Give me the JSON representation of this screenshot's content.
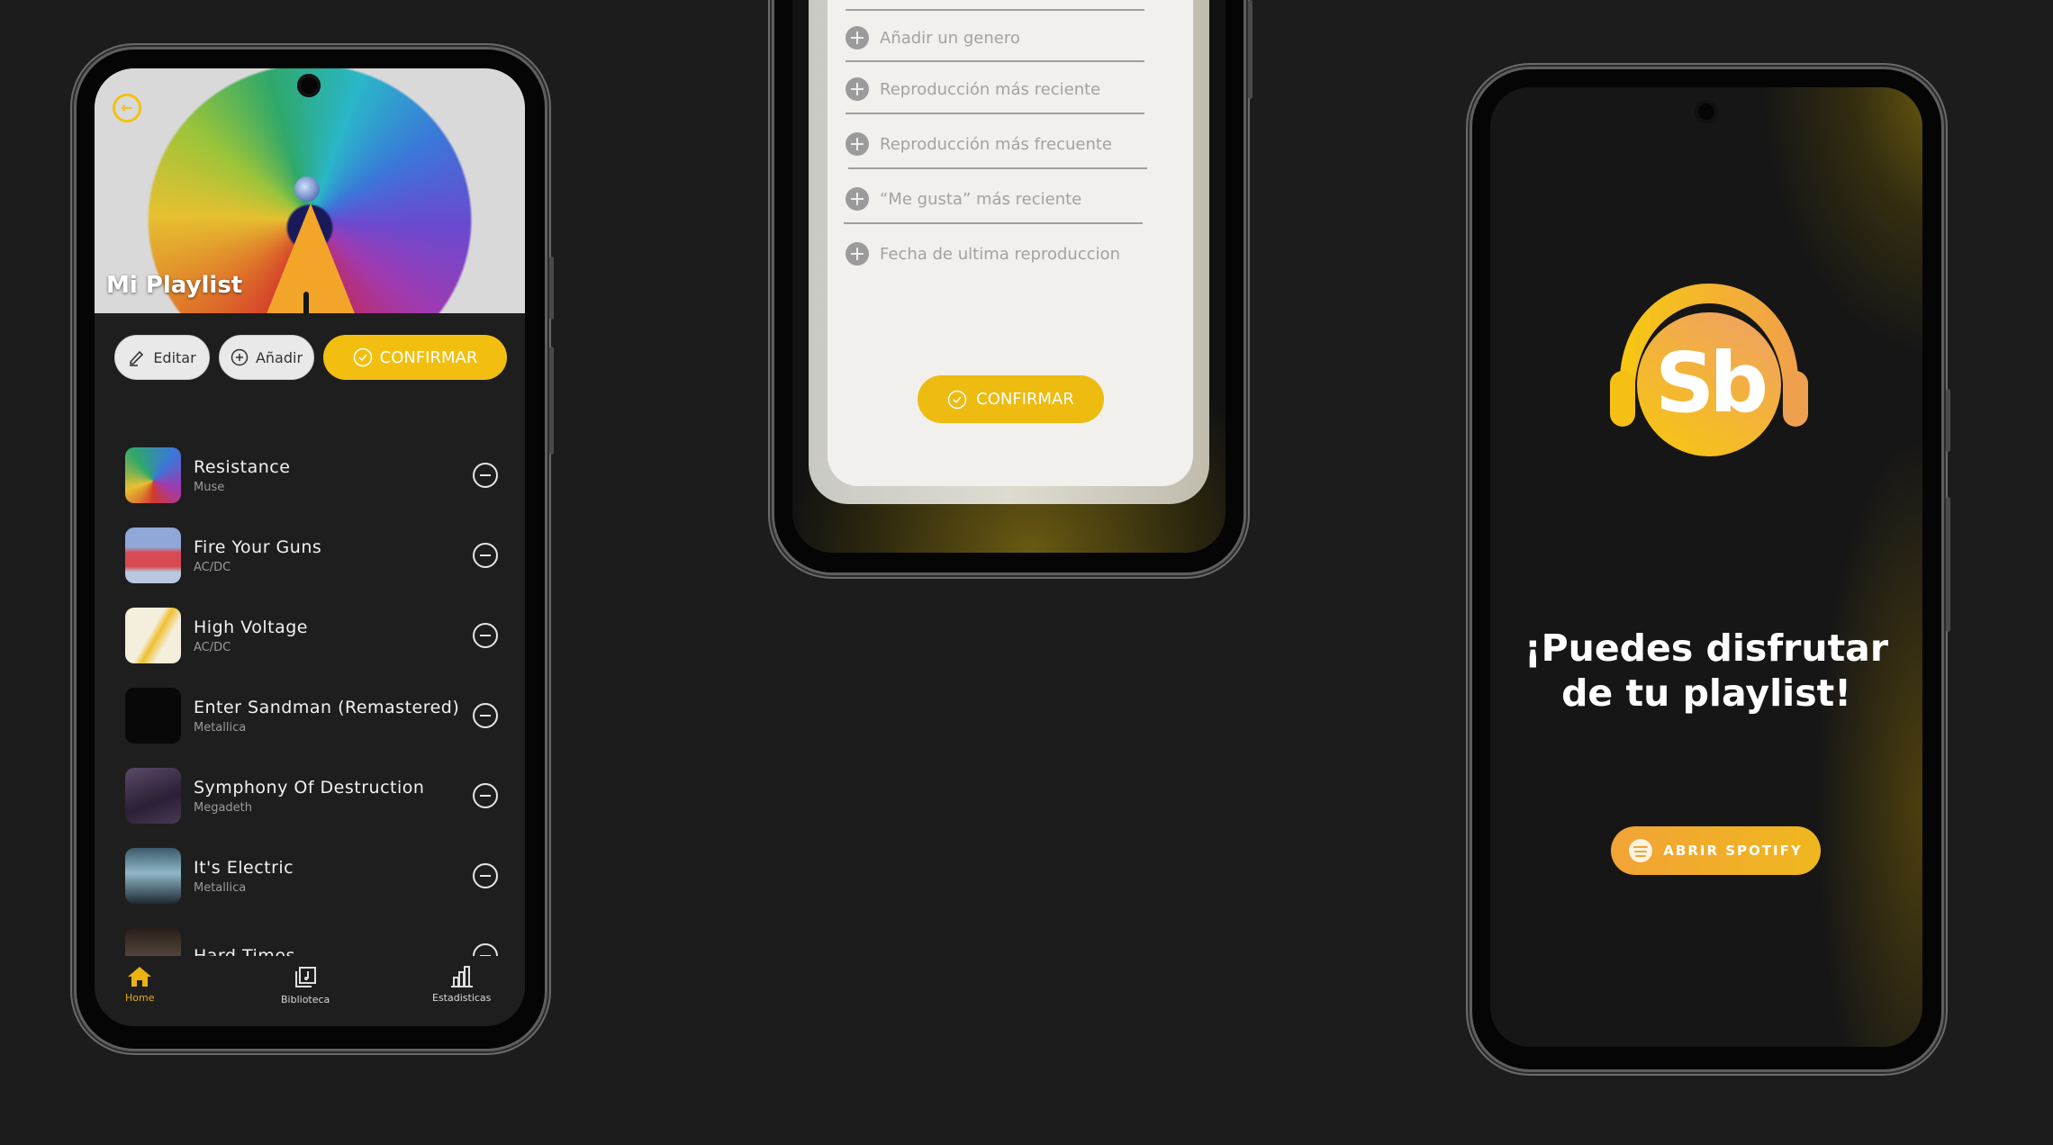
{
  "screens": {
    "playlist": {
      "title": "Mi Playlist",
      "back_icon": "arrow-left-circle-icon",
      "buttons": {
        "edit": "Editar",
        "add": "Añadir",
        "confirm": "CONFIRMAR"
      },
      "songs": [
        {
          "title": "Resistance",
          "artist": "Muse"
        },
        {
          "title": "Fire Your Guns",
          "artist": "AC/DC"
        },
        {
          "title": "High Voltage",
          "artist": "AC/DC"
        },
        {
          "title": "Enter Sandman (Remastered)",
          "artist": "Metallica"
        },
        {
          "title": "Symphony Of Destruction",
          "artist": "Megadeth"
        },
        {
          "title": "It's Electric",
          "artist": "Metallica"
        },
        {
          "title": "Hard Times",
          "artist": ""
        }
      ],
      "nav": [
        {
          "label": "Home",
          "icon": "home-icon",
          "active": true
        },
        {
          "label": "Biblioteca",
          "icon": "library-icon",
          "active": false
        },
        {
          "label": "Estadisticas",
          "icon": "bar-chart-icon",
          "active": false
        }
      ]
    },
    "filters": {
      "options": [
        "Añadir un genero",
        "Reproducción más reciente",
        "Reproducción más frecuente",
        "“Me gusta” más reciente",
        "Fecha de ultima reproduccion"
      ],
      "confirm": "CONFIRMAR"
    },
    "success": {
      "logo_text": "Sb",
      "headline_line1": "¡Puedes disfrutar",
      "headline_line2": "de tu playlist!",
      "button": "ABRIR SPOTIFY"
    }
  },
  "colors": {
    "accent_yellow": "#f2bf10",
    "accent_orange": "#f2a336",
    "background": "#1c1c1c"
  }
}
